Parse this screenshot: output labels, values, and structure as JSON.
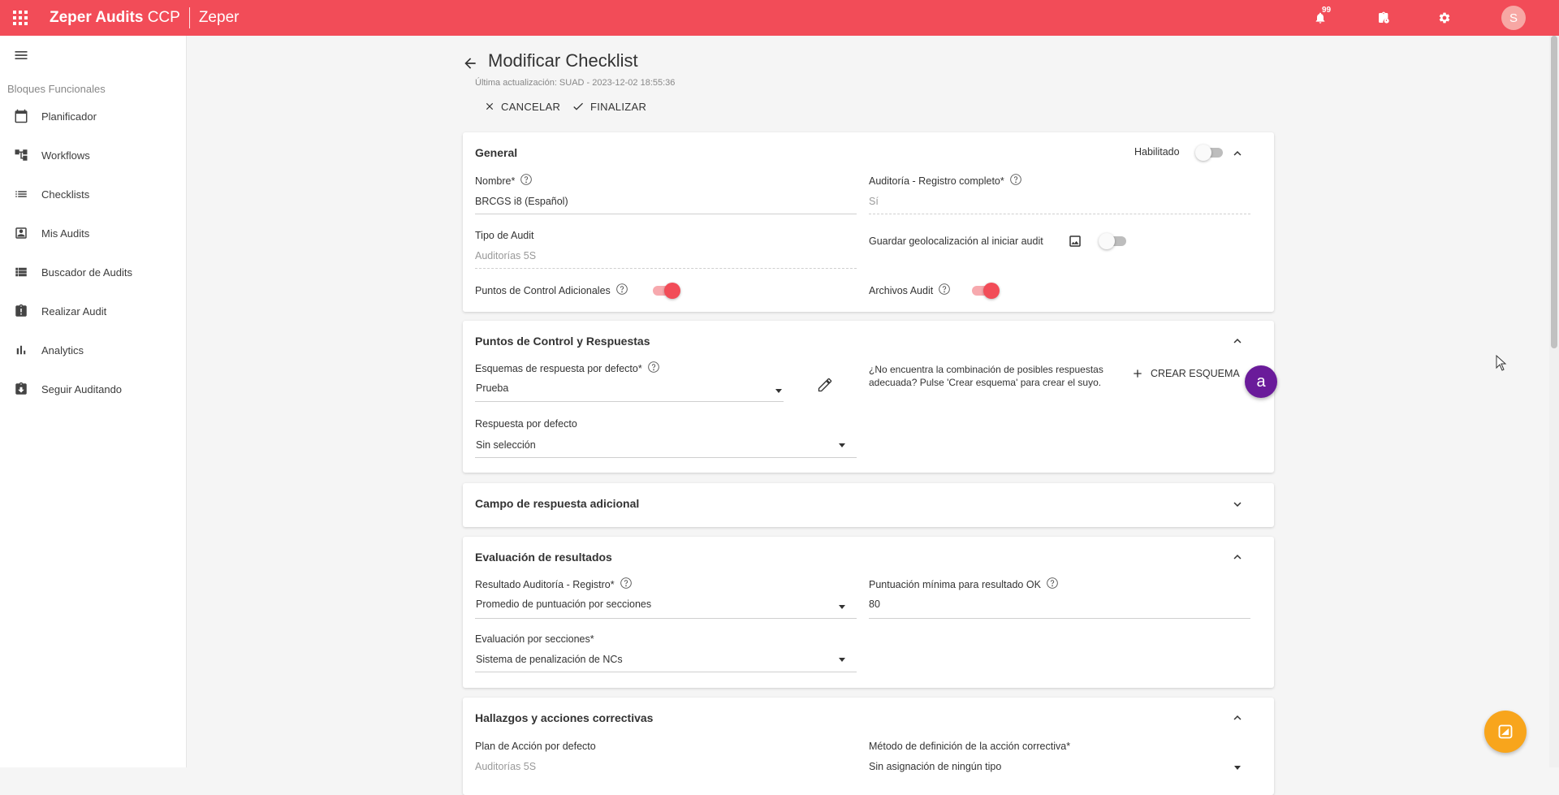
{
  "topbar": {
    "app_name_bold": "Zeper Audits",
    "app_name_suffix": " CCP",
    "org": "Zeper",
    "notifications_count": "99",
    "avatar_initial": "S",
    "accent_color": "#f24c58"
  },
  "sidebar": {
    "section_title": "Bloques Funcionales",
    "items": [
      {
        "label": "Planificador",
        "icon": "calendar-icon"
      },
      {
        "label": "Workflows",
        "icon": "workflow-icon"
      },
      {
        "label": "Checklists",
        "icon": "list-icon"
      },
      {
        "label": "Mis Audits",
        "icon": "contact-card-icon"
      },
      {
        "label": "Buscador de Audits",
        "icon": "list-search-icon"
      },
      {
        "label": "Realizar Audit",
        "icon": "clipboard-alert-icon"
      },
      {
        "label": "Analytics",
        "icon": "bar-chart-icon"
      },
      {
        "label": "Seguir Auditando",
        "icon": "clipboard-download-icon"
      }
    ]
  },
  "header": {
    "title": "Modificar Checklist",
    "last_update": "Última actualización: SUAD - 2023-12-02 18:55:36",
    "cancel_label": "CANCELAR",
    "finish_label": "FINALIZAR"
  },
  "general": {
    "title": "General",
    "enabled_label": "Habilitado",
    "enabled": false,
    "nombre_label": "Nombre*",
    "nombre_value": "BRCGS i8 (Español)",
    "registro_label": "Auditoría - Registro completo*",
    "registro_value": "Sí",
    "tipo_label": "Tipo de Audit",
    "tipo_value": "Auditorías 5S",
    "geo_label": "Guardar geolocalización al iniciar audit",
    "geo_enabled": false,
    "puntos_label": "Puntos de Control Adicionales",
    "puntos_enabled": true,
    "archivos_label": "Archivos Audit",
    "archivos_enabled": true
  },
  "puntos_control": {
    "title": "Puntos de Control y Respuestas",
    "esquemas_label": "Esquemas de respuesta por defecto*",
    "esquemas_value": "Prueba",
    "respuesta_label": "Respuesta por defecto",
    "respuesta_value": "Sin selección",
    "hint": "¿No encuentra la combinación de posibles respuestas adecuada? Pulse 'Crear esquema' para crear el suyo.",
    "crear_label": "CREAR ESQUEMA",
    "fab_label": "a"
  },
  "campo_adicional": {
    "title": "Campo de respuesta adicional"
  },
  "evaluacion": {
    "title": "Evaluación de resultados",
    "resultado_label": "Resultado Auditoría - Registro*",
    "resultado_value": "Promedio de puntuación por secciones",
    "puntuacion_label": "Puntuación mínima para resultado OK",
    "puntuacion_value": "80",
    "secciones_label": "Evaluación por secciones*",
    "secciones_value": "Sistema de penalización de NCs"
  },
  "hallazgos": {
    "title": "Hallazgos y acciones correctivas",
    "plan_label": "Plan de Acción por defecto",
    "plan_value": "Auditorías 5S",
    "metodo_label": "Método de definición de la acción correctiva*",
    "metodo_value": "Sin asignación de ningún tipo"
  }
}
